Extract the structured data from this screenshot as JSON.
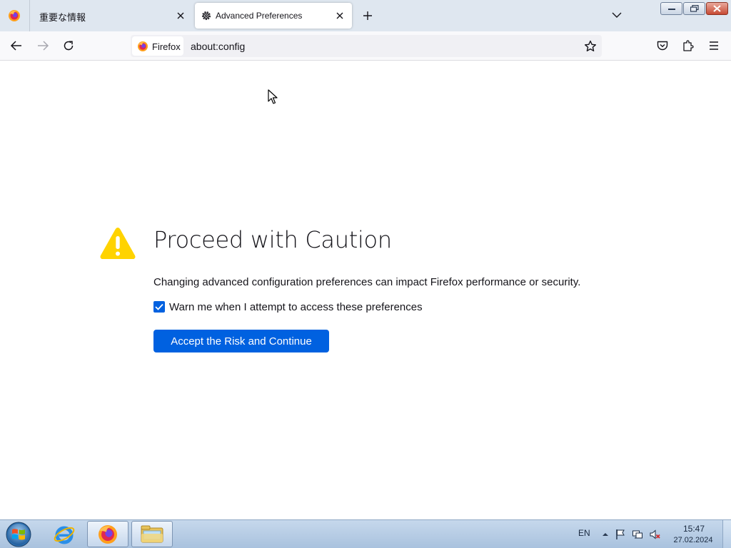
{
  "browser": {
    "tabs": [
      {
        "title": "重要な情報",
        "active": false
      },
      {
        "title": "Advanced Preferences",
        "active": true
      }
    ],
    "identity_label": "Firefox",
    "url": "about:config"
  },
  "page": {
    "title": "Proceed with Caution",
    "description": "Changing advanced configuration preferences can impact Firefox performance or security.",
    "checkbox_label": "Warn me when I attempt to access these preferences",
    "checkbox_checked": true,
    "accept_button": "Accept the Risk and Continue"
  },
  "taskbar": {
    "language": "EN",
    "time": "15:47",
    "date": "27.02.2024"
  },
  "colors": {
    "accent": "#0061e0",
    "warning": "#ffd300",
    "tabstrip": "#dfe7f0"
  },
  "icons": [
    "firefox-icon",
    "gear-icon",
    "close-icon",
    "plus-icon",
    "chevron-down-icon",
    "back-arrow-icon",
    "forward-arrow-icon",
    "reload-icon",
    "star-icon",
    "pocket-icon",
    "extensions-icon",
    "hamburger-menu-icon",
    "warning-icon",
    "checkmark-icon",
    "windows-start-icon",
    "internet-explorer-icon",
    "folder-icon"
  ]
}
